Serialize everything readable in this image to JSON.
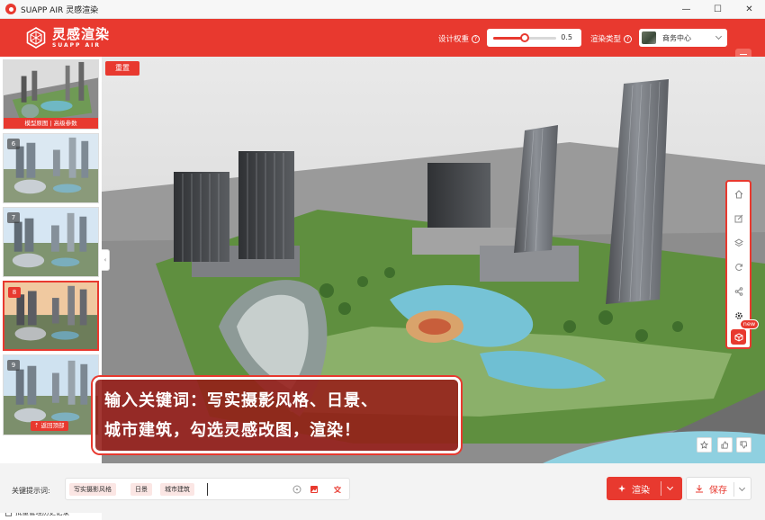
{
  "window": {
    "title": "SUAPP AIR 灵感渲染",
    "controls": [
      "—",
      "☐",
      "✕"
    ]
  },
  "header": {
    "logo_main": "灵感渲染",
    "logo_sub": "SUAPP AIR",
    "design_weight_label": "设计权重",
    "design_weight_value": "0.5",
    "design_weight_fraction": 0.5,
    "render_type_label": "渲染类型",
    "render_type_value": "商务中心"
  },
  "sidebar": {
    "thumbs": [
      {
        "num": "",
        "bar": "模型原图 | 高级参数"
      },
      {
        "num": "6"
      },
      {
        "num": "7"
      },
      {
        "num": "8"
      },
      {
        "num": "9",
        "back_top": "返回顶部"
      }
    ],
    "history": "批量管理历史记录"
  },
  "viewport": {
    "reset": "重置",
    "new_badge": "new"
  },
  "caption": {
    "line1": "输入关键词：写实摄影风格、日景、",
    "line2": "城市建筑，勾选灵感改图，渲染！"
  },
  "bottom": {
    "kw_label": "关键提示词:",
    "chips": [
      "写实摄影风格",
      "日景",
      "城市建筑"
    ],
    "render": "渲染",
    "save": "保存"
  },
  "colors": {
    "brand": "#e8392f"
  }
}
